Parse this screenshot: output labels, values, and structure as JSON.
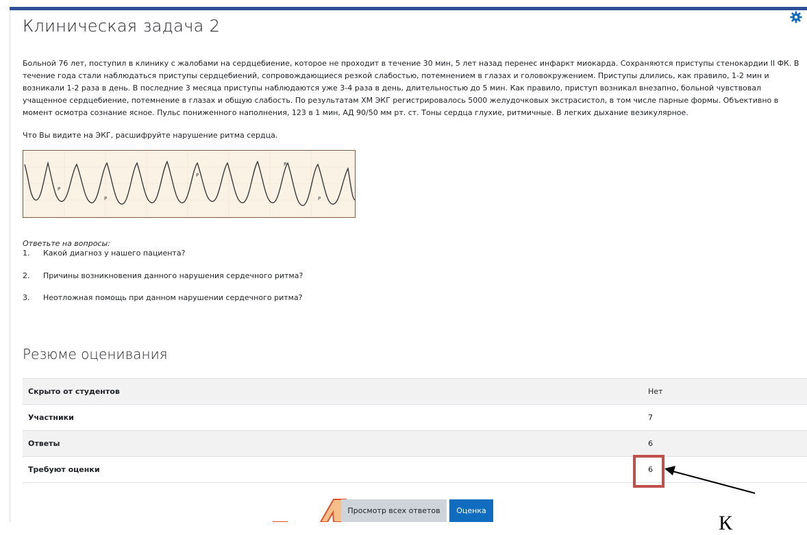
{
  "page": {
    "title": "Клиническая задача 2",
    "description": "Больной 76 лет, поступил в клинику с жалобами на сердцебиение, которое не проходит в течение 30 мин, 5 лет назад перенес инфаркт миокарда. Сохраняются приступы стенокардии II ФК. В течение года стали наблюдаться приступы сердцебиений, сопровождающиеся резкой слабостью, потемнением в глазах и головокружением. Приступы длились, как правило, 1-2 мин и возникали 1-2 раза в день. В последние 3 месяца приступы наблюдаются уже 3-4 раза в день, длительностью до 5 мин. Как правило, приступ возникал внезапно, больной чувствовал учащенное сердцебиение, потемнение в глазах и общую слабость. По результатам ХМ ЭКГ регистрировалось 5000 желудочковых экстрасистол, в том числе парные формы. Объективно в момент осмотра сознание ясное. Пульс пониженного наполнения, 123 в 1 мин, АД 90/50 мм рт. ст. Тоны сердца глухие, ритмичные. В легких дыхание везикулярное.",
    "ecg_question": "Что Вы видите на ЭКГ, расшифруйте нарушение ритма сердца.",
    "answer_prompt": "Ответьте на вопросы:",
    "questions": [
      {
        "num": "1.",
        "text": "Какой диагноз у нашего пациента?"
      },
      {
        "num": "2.",
        "text": "Причины возникновения данного нарушения сердечного ритма?"
      },
      {
        "num": "3.",
        "text": "Неотложная помощь при данном нарушении сердечного ритма?"
      }
    ]
  },
  "ecg": {
    "labels": [
      "P",
      "P",
      "P",
      "P",
      "P"
    ]
  },
  "summary": {
    "heading": "Резюме оценивания",
    "rows": [
      {
        "label": "Скрыто от студентов",
        "value": "Нет"
      },
      {
        "label": "Участники",
        "value": "7"
      },
      {
        "label": "Ответы",
        "value": "6"
      },
      {
        "label": "Требуют оценки",
        "value": "6"
      }
    ]
  },
  "buttons": {
    "view_all": "Просмотр всех ответов",
    "grade": "Оценка"
  },
  "annotation": {
    "callout_text": "К"
  },
  "colors": {
    "accent": "#0f6cbf",
    "topbar": "#2f4f96",
    "highlight_box": "#c0504d",
    "callout_arrow": "#f4a460"
  }
}
